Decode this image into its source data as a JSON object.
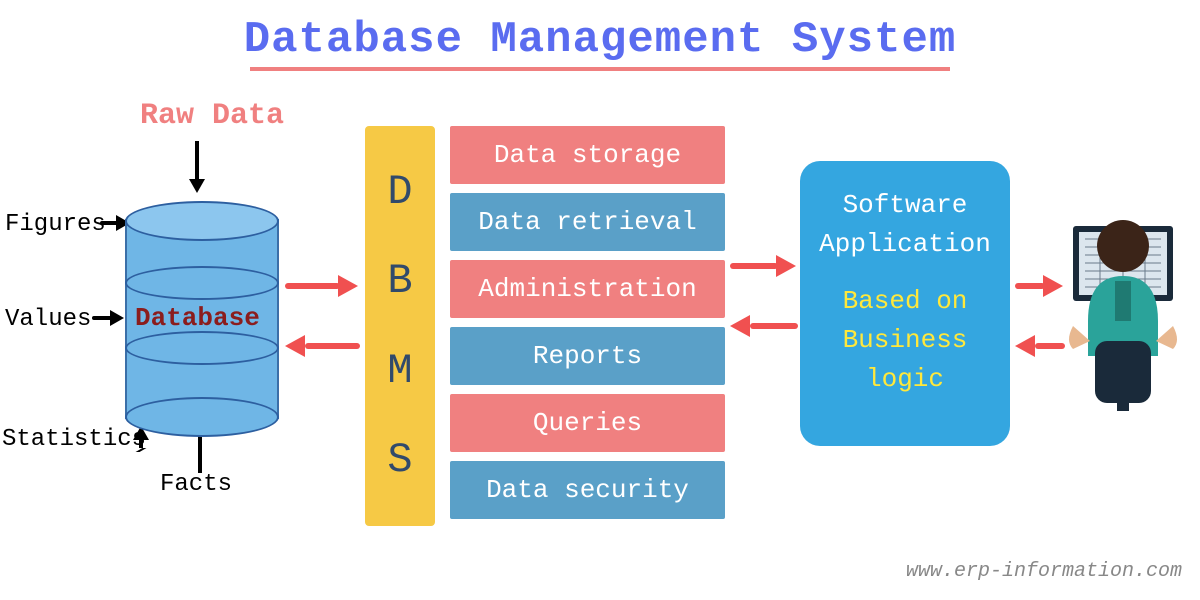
{
  "title": "Database Management System",
  "raw_data_label": "Raw Data",
  "inputs": {
    "figures": "Figures",
    "values": "Values",
    "statistics": "Statistics",
    "facts": "Facts"
  },
  "database_label": "Database",
  "dbms_letters": [
    "D",
    "B",
    "M",
    "S"
  ],
  "functions": [
    {
      "label": "Data storage",
      "color": "pink"
    },
    {
      "label": "Data retrieval",
      "color": "blue"
    },
    {
      "label": "Administration",
      "color": "pink"
    },
    {
      "label": "Reports",
      "color": "blue"
    },
    {
      "label": "Queries",
      "color": "pink"
    },
    {
      "label": "Data security",
      "color": "blue"
    }
  ],
  "app": {
    "line1": "Software",
    "line2": "Application",
    "line3": "Based on",
    "line4": "Business",
    "line5": "logic"
  },
  "footer": "www.erp-information.com"
}
